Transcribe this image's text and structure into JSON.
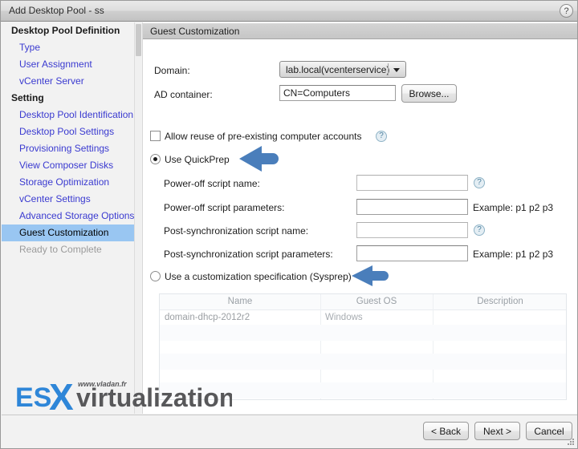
{
  "window": {
    "title": "Add Desktop Pool - ss",
    "help_icon": "question-mark-icon"
  },
  "sidebar": {
    "groups": [
      {
        "label": "Desktop Pool Definition",
        "items": [
          {
            "label": "Type",
            "state": "link"
          },
          {
            "label": "User Assignment",
            "state": "link"
          },
          {
            "label": "vCenter Server",
            "state": "link"
          }
        ]
      },
      {
        "label": "Setting",
        "items": [
          {
            "label": "Desktop Pool Identification",
            "state": "link"
          },
          {
            "label": "Desktop Pool Settings",
            "state": "link"
          },
          {
            "label": "Provisioning Settings",
            "state": "link"
          },
          {
            "label": "View Composer Disks",
            "state": "link"
          },
          {
            "label": "Storage Optimization",
            "state": "link"
          },
          {
            "label": "vCenter Settings",
            "state": "link"
          },
          {
            "label": "Advanced Storage Options",
            "state": "link"
          },
          {
            "label": "Guest Customization",
            "state": "selected"
          },
          {
            "label": "Ready to Complete",
            "state": "disabled"
          }
        ]
      }
    ]
  },
  "content": {
    "header": "Guest Customization",
    "refresh_icon": "refresh-icon",
    "domain": {
      "label": "Domain:",
      "value": "lab.local(vcenterservice)"
    },
    "ad_container": {
      "label": "AD container:",
      "value": "CN=Computers",
      "browse_label": "Browse..."
    },
    "allow_reuse": {
      "label": "Allow reuse of pre-existing computer accounts",
      "checked": false,
      "help_icon": "help-question-icon"
    },
    "quickprep": {
      "label": "Use QuickPrep",
      "selected": true,
      "fields": [
        {
          "label": "Power-off script name:",
          "value": "",
          "hint": "",
          "help": true
        },
        {
          "label": "Power-off script parameters:",
          "value": "",
          "hint": "Example: p1 p2 p3",
          "help": false
        },
        {
          "label": "Post-synchronization script name:",
          "value": "",
          "hint": "",
          "help": true
        },
        {
          "label": "Post-synchronization script parameters:",
          "value": "",
          "hint": "Example: p1 p2 p3",
          "help": false
        }
      ]
    },
    "sysprep": {
      "label": "Use a customization specification (Sysprep)",
      "selected": false,
      "table": {
        "columns": [
          "Name",
          "Guest OS",
          "Description"
        ],
        "rows": [
          [
            "domain-dhcp-2012r2",
            "Windows",
            ""
          ]
        ]
      }
    }
  },
  "annotations": {
    "arrow_color": "#4a7ebb",
    "arrows": [
      {
        "name": "arrow-pointing-to-use-quickprep"
      },
      {
        "name": "arrow-pointing-to-sysprep-option"
      }
    ]
  },
  "watermark": {
    "prefix": "ES",
    "x_letter": "X",
    "suffix": "virtualization",
    "url": "www.vladan.fr",
    "blue": "#2e86d8",
    "dark": "#58585a"
  },
  "footer": {
    "back_label": "< Back",
    "next_label": "Next >",
    "cancel_label": "Cancel"
  }
}
